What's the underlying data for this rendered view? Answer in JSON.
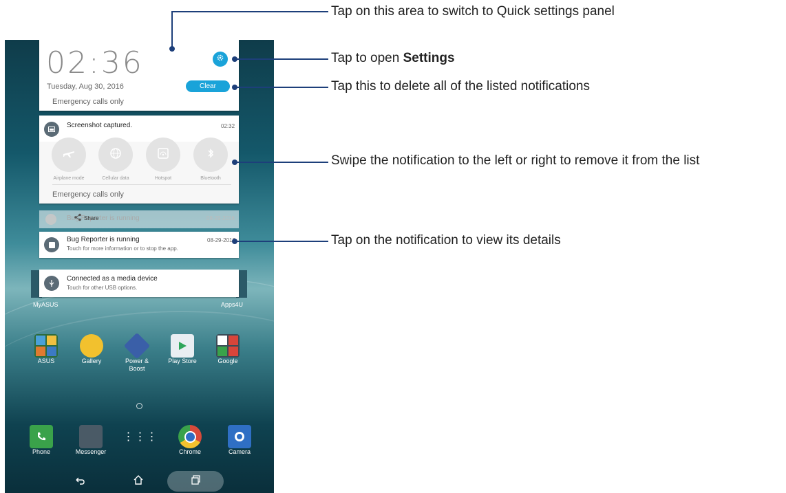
{
  "notification_panel": {
    "time": "02:36",
    "date": "Tuesday, Aug 30, 2016",
    "emergency_text": "Emergency calls only",
    "clear_label": "Clear",
    "settings_icon": "gear-icon"
  },
  "notifications": [
    {
      "title": "Screenshot captured.",
      "subtitle": "",
      "time": "02:32",
      "icon": "screenshot-icon"
    },
    {
      "title": "Bug Reporter is running",
      "subtitle": "Touch for more information or to stop the app.",
      "time": "08-29-2016",
      "icon": "stop-icon"
    },
    {
      "title": "Connected as a media device",
      "subtitle": "Touch for other USB options.",
      "time": "",
      "icon": "usb-icon"
    }
  ],
  "ghost_notification": {
    "title": "Bug Reporter is running",
    "time": "08-29-2016",
    "share_label": "Share"
  },
  "quick_settings": {
    "items": [
      {
        "label": "Airplane mode",
        "icon": "airplane-icon"
      },
      {
        "label": "Cellular data",
        "icon": "cellular-data-icon"
      },
      {
        "label": "Hotspot",
        "icon": "hotspot-icon"
      },
      {
        "label": "Bluetooth",
        "icon": "bluetooth-icon"
      }
    ],
    "emergency_text": "Emergency calls only"
  },
  "home_screen": {
    "widget_labels": {
      "left": "MyASUS",
      "right": "Apps4U"
    },
    "apps": [
      {
        "label": "ASUS",
        "color": "#2d6b3c"
      },
      {
        "label": "Gallery",
        "color": "#f2c12e"
      },
      {
        "label": "Power &\nBoost",
        "color": "#3a5fa8"
      },
      {
        "label": "Play Store",
        "color": "#e9eef2"
      },
      {
        "label": "Google",
        "color": "#3b4a56"
      }
    ],
    "dock": [
      {
        "label": "Phone",
        "color": "#3aa24a"
      },
      {
        "label": "Messenger",
        "color": "#4a5a66"
      },
      {
        "label": "",
        "color": "#7a8a92"
      },
      {
        "label": "Chrome",
        "color": "#d84a3a"
      },
      {
        "label": "Camera",
        "color": "#2f6fc4"
      }
    ]
  },
  "nav_bar": {
    "back_icon": "back-icon",
    "home_icon": "home-icon",
    "recents_icon": "recents-icon"
  },
  "callouts": {
    "quick_settings": "Tap on this area to switch to Quick settings panel",
    "settings_prefix": "Tap to open ",
    "settings_bold": "Settings",
    "clear": "Tap this to delete all of the listed notifications",
    "swipe": "Swipe the notification to the left or right to remove it from the list",
    "details": "Tap on the notification to view its details"
  },
  "colors": {
    "accent": "#1aa3d9",
    "callout_line": "#1d3f7a"
  }
}
